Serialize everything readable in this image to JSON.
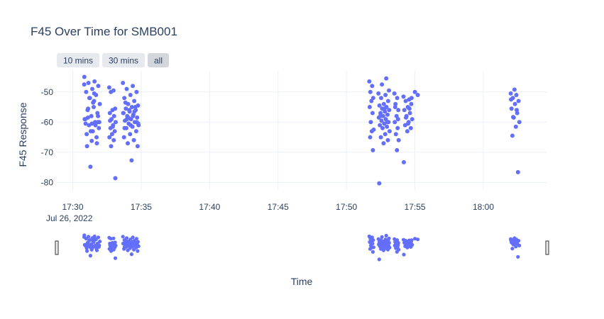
{
  "chart_data": {
    "type": "scatter",
    "title": "F45 Over Time for SMB001",
    "xlabel": "Time",
    "ylabel": "F45 Response",
    "date_label": "Jul 26, 2022",
    "x_tick_labels": [
      "17:30",
      "17:35",
      "17:40",
      "17:45",
      "17:50",
      "17:55",
      "18:00"
    ],
    "y_tick_labels": [
      "-50",
      "-60",
      "-70",
      "-80"
    ],
    "xlim": [
      "17:28:50",
      "18:04:40"
    ],
    "ylim": [
      -82.5,
      -43
    ],
    "marker_color": "#636efa",
    "range_buttons": [
      {
        "label": "10 mins",
        "active": false
      },
      {
        "label": "30 mins",
        "active": false
      },
      {
        "label": "all",
        "active": true
      }
    ],
    "range_slider": true,
    "grid": true,
    "clusters": [
      {
        "x_start": "17:30:50",
        "x_end": "17:32:00",
        "y": [
          -47.5,
          -53,
          -58.5,
          -60,
          -66.2,
          -60.5,
          -61,
          -52,
          -60,
          -53.5,
          -68,
          -67,
          -63,
          -59,
          -46.5,
          -47,
          -48,
          -49,
          -50,
          -51,
          -52,
          -54,
          -55,
          -56,
          -57,
          -58,
          -59,
          -60,
          -61,
          -62,
          -63,
          -64,
          -65,
          -74.8,
          -45,
          -50.5,
          -55.5,
          -58,
          -60.5
        ]
      },
      {
        "x_start": "17:32:40",
        "x_end": "17:33:10",
        "y": [
          -48.5,
          -49.5,
          -50,
          -55.5,
          -56,
          -57,
          -58,
          -59,
          -60,
          -61,
          -62,
          -63,
          -64,
          -65,
          -66,
          -68,
          -78.6,
          -61.5,
          -59.5
        ]
      },
      {
        "x_start": "17:33:40",
        "x_end": "17:34:50",
        "y": [
          -47,
          -48,
          -49,
          -50,
          -51,
          -52,
          -53,
          -54,
          -54.5,
          -55,
          -55.5,
          -56,
          -56.5,
          -57,
          -57.5,
          -58,
          -58.5,
          -59,
          -59.5,
          -60,
          -60.5,
          -61,
          -61.5,
          -62,
          -63,
          -64,
          -65,
          -66,
          -67,
          -68,
          -72.7,
          -53.5,
          -55,
          -56,
          -57,
          -58,
          -59,
          -60,
          -61,
          -62,
          -56.5,
          -58.5,
          -60.5
        ]
      },
      {
        "x_start": "17:51:40",
        "x_end": "17:52:00",
        "y": [
          -46.5,
          -48,
          -50,
          -52,
          -53,
          -55,
          -57,
          -60,
          -62.5,
          -63,
          -65,
          -69.3
        ]
      },
      {
        "x_start": "17:52:20",
        "x_end": "17:53:10",
        "y": [
          -50.5,
          -51,
          -52,
          -53,
          -54,
          -54.5,
          -55,
          -55.5,
          -56,
          -56.5,
          -57,
          -57.5,
          -58,
          -58.5,
          -59,
          -59.5,
          -60,
          -60.5,
          -61,
          -61.5,
          -62,
          -63,
          -64,
          -65,
          -66,
          -67,
          -80.3,
          -45.5,
          -47.5,
          -49.5,
          -55.5,
          -58,
          -60
        ]
      },
      {
        "x_start": "17:53:30",
        "x_end": "17:53:50",
        "y": [
          -50.5,
          -52,
          -54,
          -56,
          -58,
          -60,
          -62,
          -64,
          -66,
          -69.3,
          -55,
          -59
        ]
      },
      {
        "x_start": "17:54:10",
        "x_end": "17:54:50",
        "y": [
          -51.5,
          -52.5,
          -53,
          -54,
          -55,
          -56,
          -57,
          -58,
          -59,
          -60,
          -61,
          -62,
          -63,
          -73.3,
          -55.5,
          -58.5,
          -52,
          -60.5
        ]
      },
      {
        "x_start": "17:55:00",
        "x_end": "17:55:20",
        "y": [
          -50,
          -51
        ]
      },
      {
        "x_start": "18:02:00",
        "x_end": "18:02:40",
        "y": [
          -50.5,
          -51,
          -52,
          -53,
          -54,
          -55.5,
          -57,
          -58.5,
          -60,
          -61.5,
          -64.5,
          -76.6,
          -49.2,
          -52.5,
          -56,
          -58.3
        ]
      }
    ]
  }
}
